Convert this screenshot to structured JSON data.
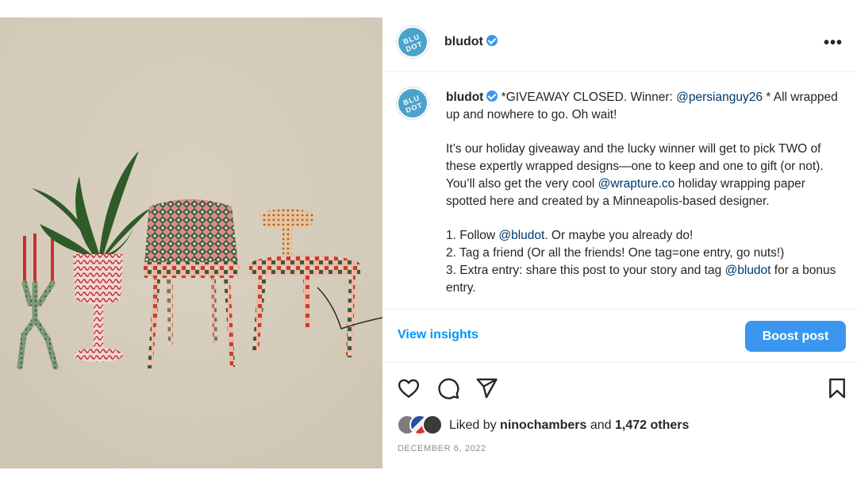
{
  "header": {
    "username": "bludot",
    "avatar_text": "BLU DOT",
    "more_icon": "ellipsis-icon"
  },
  "caption": {
    "username": "bludot",
    "line1_pre": "*GIVEAWAY CLOSED. Winner: ",
    "line1_mention": "@persianguy26",
    "line1_post": " * All wrapped up and nowhere to go. Oh wait!",
    "para2_pre": "It’s our holiday giveaway and the lucky winner will get to pick TWO of these expertly wrapped designs—one to keep and one to gift (or not). You’ll also get the very cool ",
    "para2_mention": "@wrapture.co",
    "para2_post": " holiday wrapping paper spotted here and created by a Minneapolis-based designer.",
    "step1_pre": "1. Follow ",
    "step1_mention": "@bludot",
    "step1_post": ". Or maybe you already do!",
    "step2": "2. Tag a friend (Or all the friends! One tag=one entry, go nuts!)",
    "step3_pre": "3. Extra entry: share this post to your story and tag ",
    "step3_mention": "@bludot",
    "step3_post": " for a bonus entry."
  },
  "insights": {
    "view_label": "View insights",
    "boost_label": "Boost post"
  },
  "actions": {
    "like_icon": "heart-icon",
    "comment_icon": "comment-icon",
    "share_icon": "send-icon",
    "save_icon": "bookmark-icon"
  },
  "likes": {
    "prefix": "Liked by ",
    "user": "ninochambers",
    "middle": " and ",
    "others": "1,472 others"
  },
  "date": "DECEMBER 6, 2022",
  "colors": {
    "accent": "#0095f6",
    "button": "#3a96ef",
    "avatar": "#4aa3cc",
    "mention": "#00376b",
    "image_bg": "#d8cfbf"
  }
}
